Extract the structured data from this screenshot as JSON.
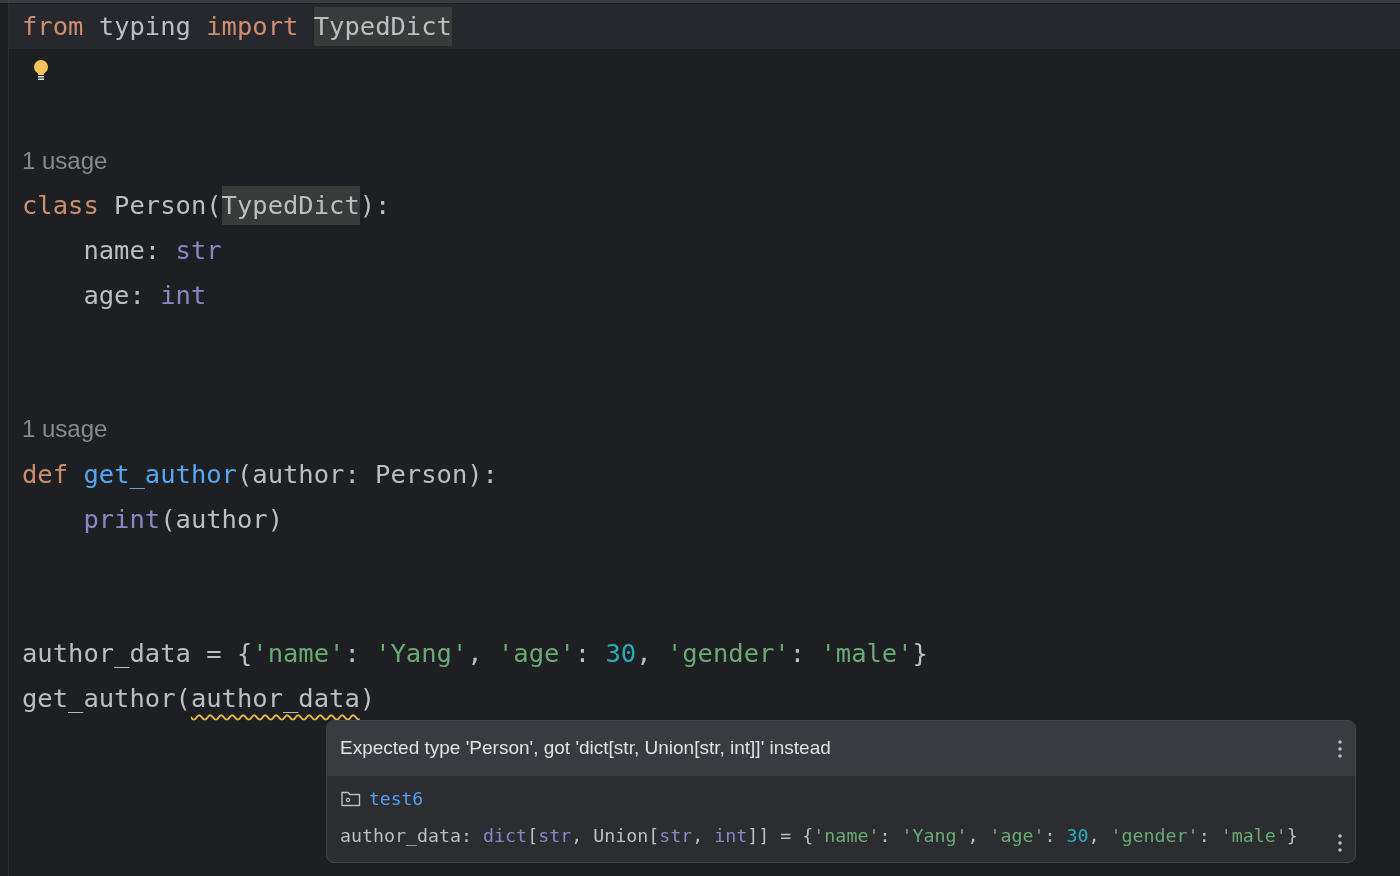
{
  "editor": {
    "lines": [
      {
        "kind": "code",
        "current": true,
        "tokens": [
          {
            "t": "from",
            "kind": "kw"
          },
          {
            "t": " typing ",
            "kind": "plain"
          },
          {
            "t": "import ",
            "kind": "kw"
          },
          {
            "t": "TypedDict",
            "kind": "ref"
          }
        ]
      },
      {
        "kind": "bulb"
      },
      {
        "kind": "blank"
      },
      {
        "kind": "usage",
        "text": "1 usage"
      },
      {
        "kind": "code",
        "current": false,
        "tokens": [
          {
            "t": "class",
            "kind": "kw"
          },
          {
            "t": " Person(",
            "kind": "plain"
          },
          {
            "t": "TypedDict",
            "kind": "ref"
          },
          {
            "t": "):",
            "kind": "plain"
          }
        ]
      },
      {
        "kind": "code",
        "current": false,
        "tokens": [
          {
            "t": "    name: ",
            "kind": "plain"
          },
          {
            "t": "str",
            "kind": "builtin"
          }
        ]
      },
      {
        "kind": "code",
        "current": false,
        "tokens": [
          {
            "t": "    age: ",
            "kind": "plain"
          },
          {
            "t": "int",
            "kind": "builtin"
          }
        ]
      },
      {
        "kind": "blank"
      },
      {
        "kind": "blank"
      },
      {
        "kind": "usage",
        "text": "1 usage"
      },
      {
        "kind": "code",
        "current": false,
        "tokens": [
          {
            "t": "def ",
            "kind": "kw"
          },
          {
            "t": "get_author",
            "kind": "func"
          },
          {
            "t": "(author: Person):",
            "kind": "plain"
          }
        ]
      },
      {
        "kind": "code",
        "current": false,
        "tokens": [
          {
            "t": "    print",
            "kind": "builtin"
          },
          {
            "t": "(author)",
            "kind": "plain"
          }
        ]
      },
      {
        "kind": "blank"
      },
      {
        "kind": "blank"
      },
      {
        "kind": "code",
        "current": false,
        "tokens": [
          {
            "t": "author_data = {",
            "kind": "plain"
          },
          {
            "t": "'name'",
            "kind": "str"
          },
          {
            "t": ": ",
            "kind": "plain"
          },
          {
            "t": "'Yang'",
            "kind": "str"
          },
          {
            "t": ", ",
            "kind": "plain"
          },
          {
            "t": "'age'",
            "kind": "str"
          },
          {
            "t": ": ",
            "kind": "plain"
          },
          {
            "t": "30",
            "kind": "num"
          },
          {
            "t": ", ",
            "kind": "plain"
          },
          {
            "t": "'gender'",
            "kind": "str"
          },
          {
            "t": ": ",
            "kind": "plain"
          },
          {
            "t": "'male'",
            "kind": "str"
          },
          {
            "t": "}",
            "kind": "plain"
          }
        ]
      },
      {
        "kind": "code",
        "current": false,
        "tokens": [
          {
            "t": "get_author(",
            "kind": "plain"
          },
          {
            "t": "author_data",
            "kind": "warn"
          },
          {
            "t": ")",
            "kind": "plain"
          }
        ]
      }
    ]
  },
  "popup": {
    "message": "Expected type 'Person', got 'dict[str, Union[str, int]]' instead",
    "module": "test6",
    "declaration": [
      {
        "t": "author_data: ",
        "kind": "plain"
      },
      {
        "t": "dict",
        "kind": "builtin"
      },
      {
        "t": "[",
        "kind": "plain"
      },
      {
        "t": "str",
        "kind": "builtin"
      },
      {
        "t": ", Union[",
        "kind": "plain"
      },
      {
        "t": "str",
        "kind": "builtin"
      },
      {
        "t": ", ",
        "kind": "plain"
      },
      {
        "t": "int",
        "kind": "builtin"
      },
      {
        "t": "]] = {",
        "kind": "plain"
      },
      {
        "t": "'name'",
        "kind": "str"
      },
      {
        "t": ": ",
        "kind": "plain"
      },
      {
        "t": "'Yang'",
        "kind": "str"
      },
      {
        "t": ", ",
        "kind": "plain"
      },
      {
        "t": "'age'",
        "kind": "str"
      },
      {
        "t": ": ",
        "kind": "plain"
      },
      {
        "t": "30",
        "kind": "num"
      },
      {
        "t": ", ",
        "kind": "plain"
      },
      {
        "t": "'gender'",
        "kind": "str"
      },
      {
        "t": ": ",
        "kind": "plain"
      },
      {
        "t": "'male'",
        "kind": "str"
      },
      {
        "t": "}",
        "kind": "plain"
      }
    ]
  }
}
